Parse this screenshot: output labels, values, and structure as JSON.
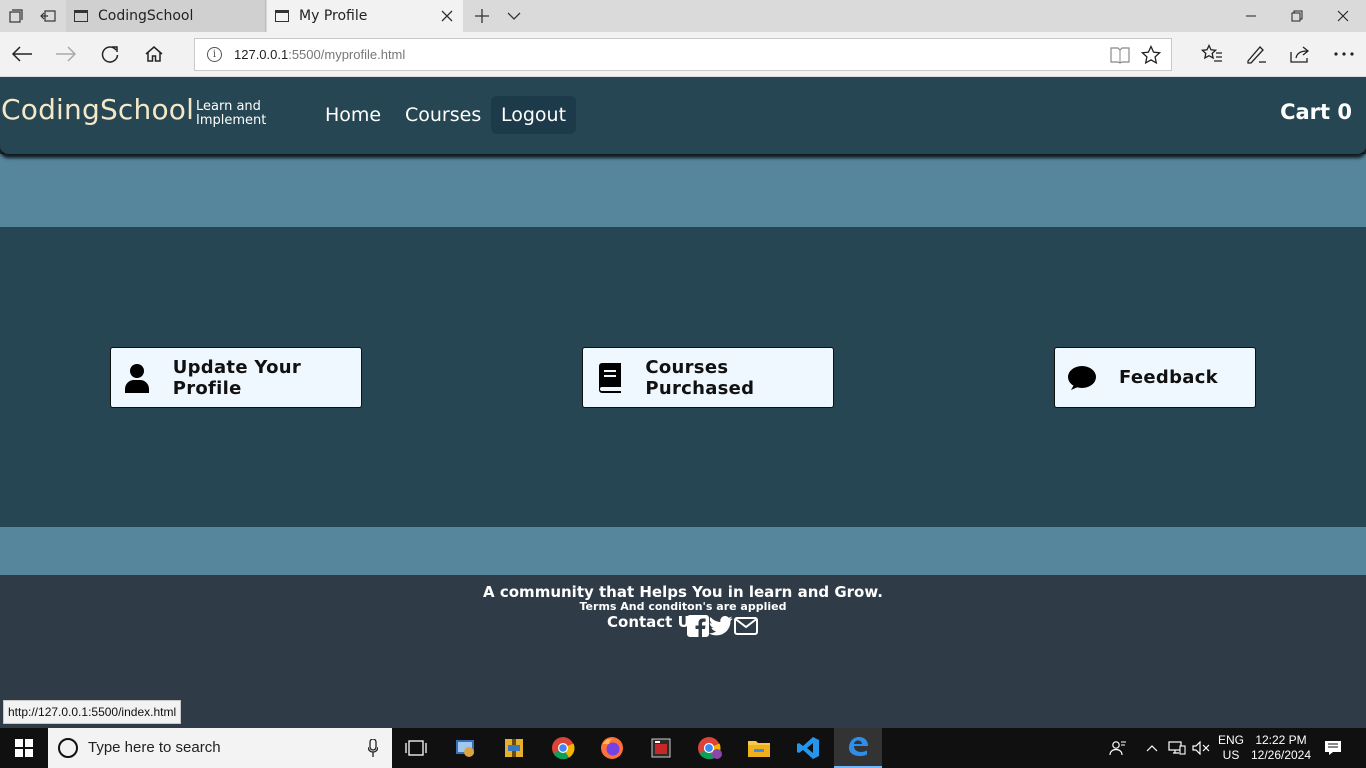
{
  "browser": {
    "tabs": [
      {
        "title": "CodingSchool",
        "active": false
      },
      {
        "title": "My Profile",
        "active": true
      }
    ],
    "url_host": "127.0.0.1",
    "url_rest": ":5500/myprofile.html",
    "status_link": "http://127.0.0.1:5500/index.html"
  },
  "navbar": {
    "brand": "CodingSchool",
    "tagline": "Learn and Implement",
    "links": [
      {
        "label": "Home",
        "active": false
      },
      {
        "label": "Courses",
        "active": false
      },
      {
        "label": "Logout",
        "active": true
      }
    ],
    "cart_label": "Cart 0"
  },
  "cards": [
    {
      "label": "Update Your Profile",
      "icon": "user-icon"
    },
    {
      "label": "Courses Purchased",
      "icon": "book-icon"
    },
    {
      "label": "Feedback",
      "icon": "comment-icon"
    }
  ],
  "footer": {
    "tagline": "A community that Helps You in learn and Grow.",
    "terms": "Terms And conditon's are applied",
    "contact": "Contact Us",
    "social_icons": [
      "facebook-icon",
      "twitter-icon",
      "envelope-icon"
    ]
  },
  "taskbar": {
    "search_placeholder": "Type here to search",
    "lang": "ENG",
    "region": "US",
    "time": "12:22 PM",
    "date": "12/26/2024"
  },
  "colors": {
    "navbar_bg": "#264653",
    "band_bg": "#56869c",
    "card_bg": "#f0f8ff",
    "brand_text": "#f4e8c9",
    "footer_bg": "#2f3c47"
  }
}
